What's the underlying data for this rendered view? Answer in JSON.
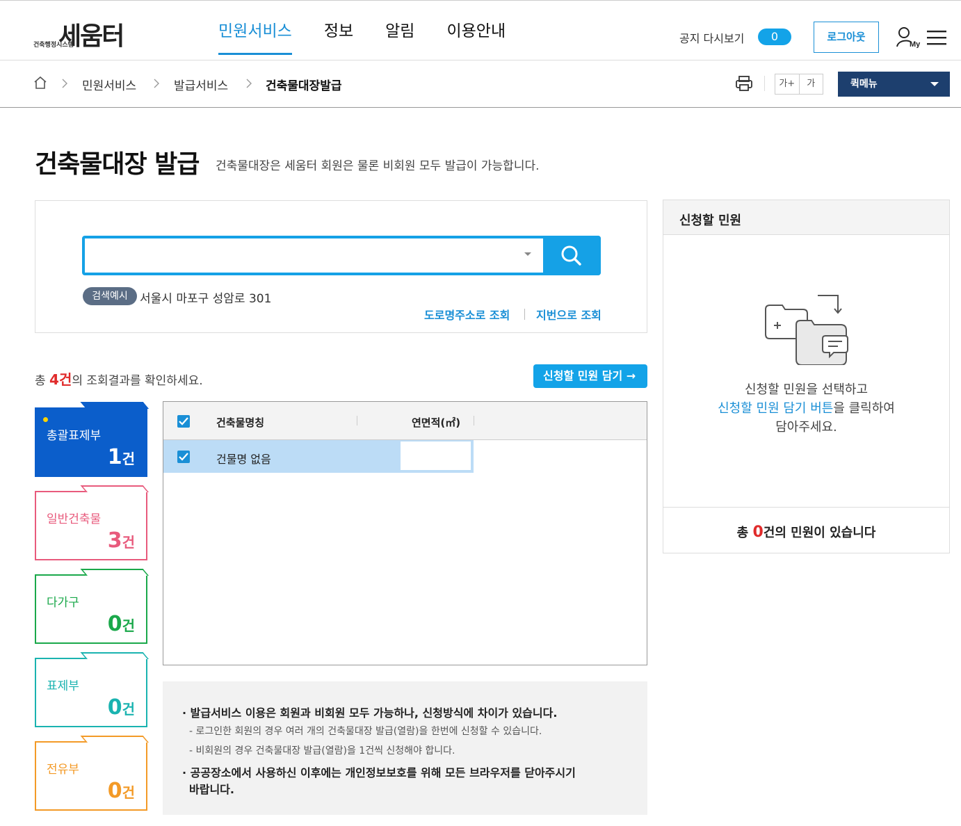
{
  "brand": {
    "logo_main": "세움터",
    "logo_sub": "건축행정시스템"
  },
  "gnb": [
    {
      "label": "민원서비스"
    },
    {
      "label": "정보"
    },
    {
      "label": "알림"
    },
    {
      "label": "이용안내"
    }
  ],
  "header": {
    "notice_label": "공지 다시보기",
    "notice_count": "0",
    "logout_label": "로그아웃"
  },
  "breadcrumb": [
    "민원서비스",
    "발급서비스",
    "건축물대장발급"
  ],
  "toolbar": {
    "font_up": "가+",
    "font_down": "가",
    "quick_menu": "퀵메뉴"
  },
  "page": {
    "title": "건축물대장 발급",
    "desc": "건축물대장은 세움터 회원은 물론 비회원 모두 발급이 가능합니다."
  },
  "search": {
    "value": "",
    "example_tag": "검색예시",
    "example_text": "서울시 마포구 성암로 301",
    "link_road": "도로명주소로 조회",
    "link_jibun": "지번으로 조회"
  },
  "results": {
    "prefix": "총 ",
    "count": "4건",
    "suffix": "의 조회결과를 확인하세요.",
    "add_button": "신청할 민원 담기 →"
  },
  "categories": [
    {
      "label": "총괄표제부",
      "count": "1",
      "unit": "건"
    },
    {
      "label": "일반건축물",
      "count": "3",
      "unit": "건"
    },
    {
      "label": "다가구",
      "count": "0",
      "unit": "건"
    },
    {
      "label": "표제부",
      "count": "0",
      "unit": "건"
    },
    {
      "label": "전유부",
      "count": "0",
      "unit": "건"
    }
  ],
  "table": {
    "headers": [
      "건축물명칭",
      "연면적(㎡)"
    ],
    "rows": [
      {
        "name": "건물명 없음",
        "area": ""
      }
    ]
  },
  "notice": {
    "line1": "· 발급서비스 이용은 회원과 비회원 모두 가능하나, 신청방식에 차이가 있습니다.",
    "sub1": "- 로그인한 회원의 경우 여러 개의 건축물대장 발급(열람)을 한번에 신청할 수 있습니다.",
    "sub2": "- 비회원의 경우 건축물대장 발급(열람)을 1건씩 신청해야 합니다.",
    "line2a": "· 공공장소에서 사용하신 이후에는 개인정보보호를 위해 모든 브라우저를 닫아주시기",
    "line2b": "바랍니다."
  },
  "cart": {
    "title": "신청할 민원",
    "msg1": "신청할 민원을 선택하고",
    "msg2_hl": "신청할 민원 담기 버튼",
    "msg2_rest": "을 클릭하여",
    "msg3": "담아주세요.",
    "total_prefix": "총 ",
    "total_count": "0",
    "total_suffix": "건의 민원이 있습니다"
  },
  "colors": {
    "accent": "#1a8fd6",
    "search_border": "#15a1e6",
    "active_tab": "#0b5ecb",
    "alert_red": "#e02b2b",
    "quick_menu_bg": "#1d3f6e"
  },
  "icons": [
    "home-icon",
    "print-icon",
    "search-icon",
    "my-user-icon",
    "hamburger-menu-icon",
    "folder-transfer-icon",
    "checkbox-icon"
  ]
}
